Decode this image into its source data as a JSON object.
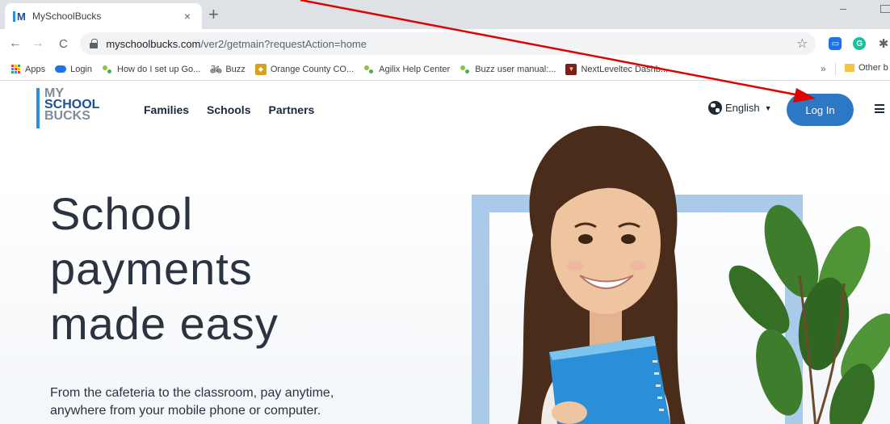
{
  "browser": {
    "tab_title": "MySchoolBucks",
    "tab_favicon": "M",
    "new_tab_label": "+",
    "close_tab_label": "×",
    "minimize_label": "–",
    "url_domain": "myschoolbucks.com",
    "url_path": "/ver2/getmain?requestAction=home",
    "bookmarks": [
      {
        "label": "Apps",
        "icon": "apps-grid-icon"
      },
      {
        "label": "Login",
        "icon": "cloud-icon"
      },
      {
        "label": "How do I set up Go...",
        "icon": "dots-icon"
      },
      {
        "label": "Buzz",
        "icon": "bike-icon"
      },
      {
        "label": "Orange County CO...",
        "icon": "occ-icon"
      },
      {
        "label": "Agilix Help Center",
        "icon": "dots-icon"
      },
      {
        "label": "Buzz user manual:...",
        "icon": "dots-icon"
      },
      {
        "label": "NextLeveltec Dashb...",
        "icon": "nlt-icon"
      }
    ],
    "bookmarks_overflow": "»",
    "other_bookmarks": "Other b"
  },
  "site": {
    "logo": {
      "line1": "MY",
      "line2": "SCHOOL",
      "line3": "BUCKS"
    },
    "nav": [
      "Families",
      "Schools",
      "Partners"
    ],
    "language": "English",
    "login_label": "Log In",
    "headline": [
      "School",
      "payments",
      "made easy"
    ],
    "subtext_lines": [
      "From the cafeteria to the classroom, pay anytime,",
      "anywhere from your mobile phone or computer."
    ]
  },
  "colors": {
    "brand_blue": "#2d78c4",
    "logo_navy": "#1d4f91",
    "logo_gray": "#7f8c99",
    "frame_blue": "#a9cbe9",
    "annotation_red": "#e00000"
  }
}
